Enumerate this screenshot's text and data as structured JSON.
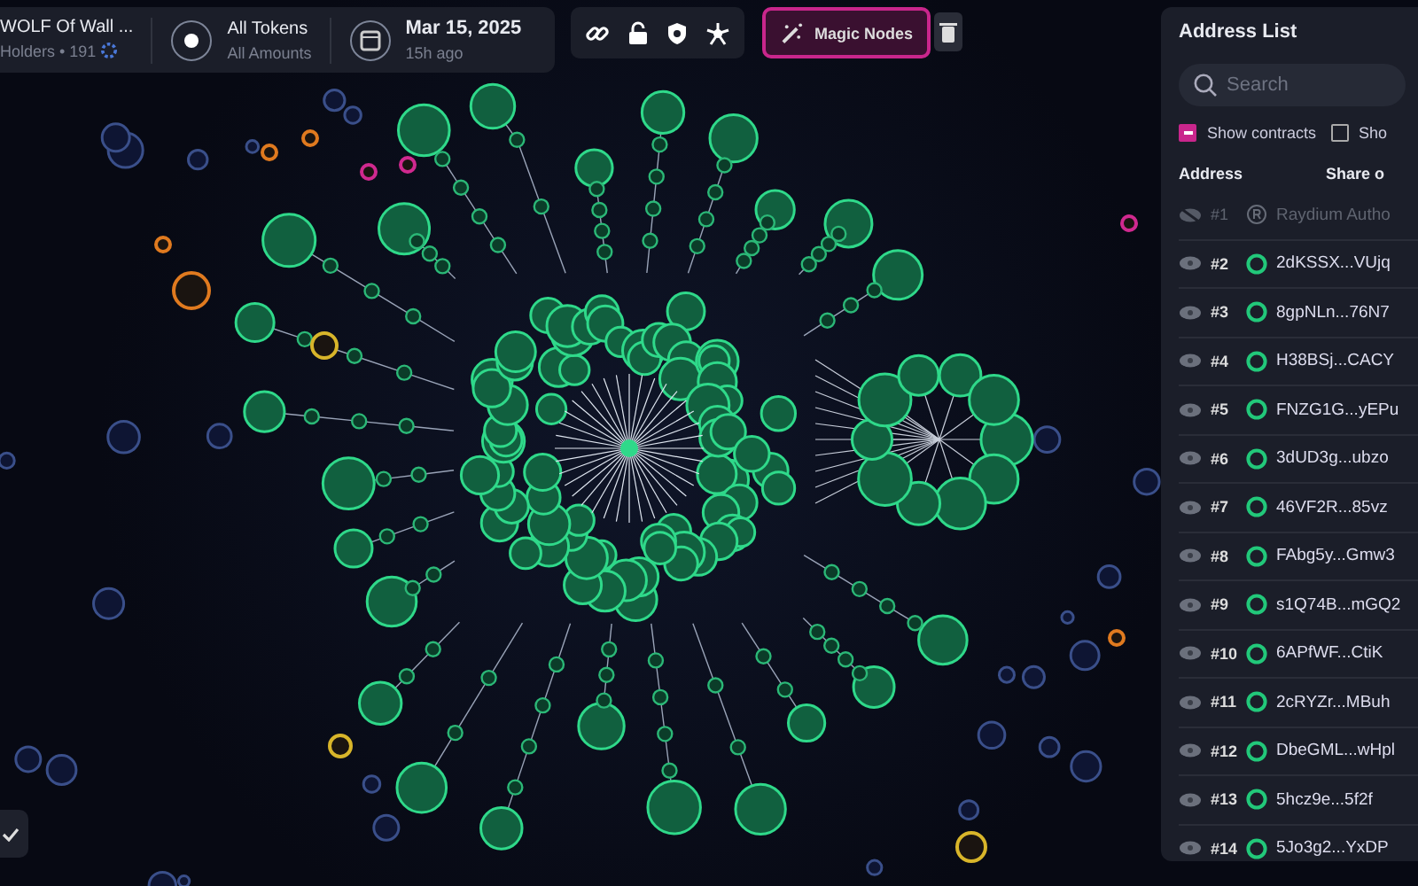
{
  "token_card": {
    "name": "WOLF Of Wall ...",
    "holders": "Holders • 191",
    "tokens_title": "All Tokens",
    "tokens_sub": "All Amounts",
    "date": "Mar 15, 2025",
    "date_sub": "15h ago"
  },
  "toolbar": {
    "magic_nodes": {
      "label": "Magic Nodes",
      "selected": true
    }
  },
  "address_list": {
    "title": "Address List",
    "search": {
      "placeholder": "Search"
    },
    "filters": [
      {
        "label": "Show contracts",
        "checked": true
      },
      {
        "label": "Sho",
        "checked": false
      }
    ],
    "columns": [
      "Address",
      "Share o"
    ],
    "rows": [
      {
        "rank": "#1",
        "address": "Raydium Autho",
        "kind": "program",
        "hidden": true
      },
      {
        "rank": "#2",
        "address": "2dKSSX...VUjq",
        "kind": "wallet",
        "hidden": false
      },
      {
        "rank": "#3",
        "address": "8gpNLn...76N7",
        "kind": "wallet",
        "hidden": false
      },
      {
        "rank": "#4",
        "address": "H38BSj...CACY",
        "kind": "wallet",
        "hidden": false
      },
      {
        "rank": "#5",
        "address": "FNZG1G...yEPu",
        "kind": "wallet",
        "hidden": false
      },
      {
        "rank": "#6",
        "address": "3dUD3g...ubzo",
        "kind": "wallet",
        "hidden": false
      },
      {
        "rank": "#7",
        "address": "46VF2R...85vz",
        "kind": "wallet",
        "hidden": false
      },
      {
        "rank": "#8",
        "address": "FAbg5y...Gmw3",
        "kind": "wallet",
        "hidden": false
      },
      {
        "rank": "#9",
        "address": "s1Q74B...mGQ2",
        "kind": "wallet",
        "hidden": false
      },
      {
        "rank": "#10",
        "address": "6APfWF...CtiK",
        "kind": "wallet",
        "hidden": false
      },
      {
        "rank": "#11",
        "address": "2cRYZr...MBuh",
        "kind": "wallet",
        "hidden": false
      },
      {
        "rank": "#12",
        "address": "DbeGML...wHpl",
        "kind": "wallet",
        "hidden": false
      },
      {
        "rank": "#13",
        "address": "5hcz9e...5f2f",
        "kind": "wallet",
        "hidden": false
      },
      {
        "rank": "#14",
        "address": "5Jo3g2...YxDP",
        "kind": "wallet",
        "hidden": false
      }
    ]
  }
}
